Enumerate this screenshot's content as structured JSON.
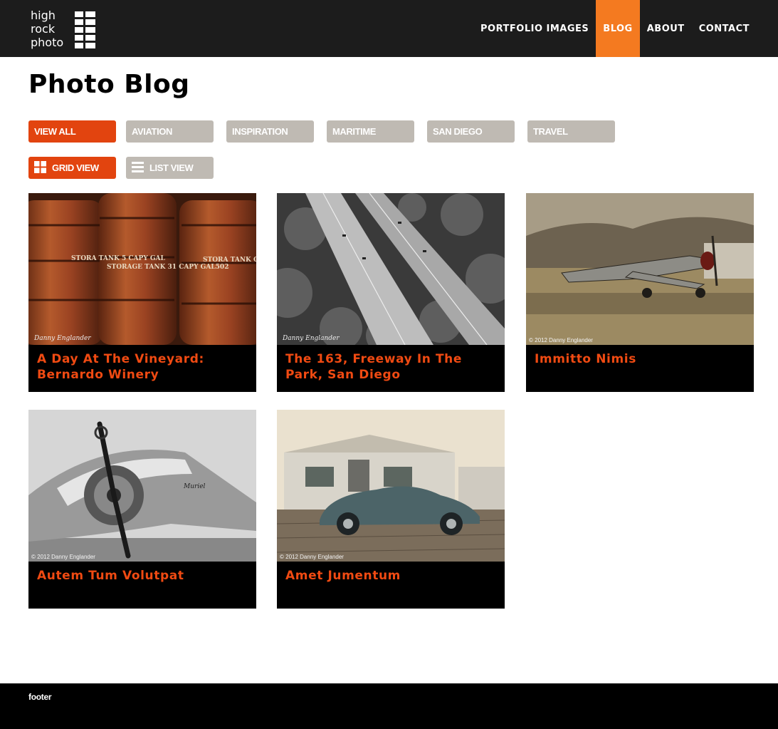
{
  "header": {
    "logo": {
      "line1": "high",
      "line2": "rock",
      "line3": "photo"
    },
    "nav": [
      {
        "label": "PORTFOLIO IMAGES",
        "active": false
      },
      {
        "label": "BLOG",
        "active": true
      },
      {
        "label": "ABOUT",
        "active": false
      },
      {
        "label": "CONTACT",
        "active": false
      }
    ]
  },
  "page": {
    "title": "Photo Blog"
  },
  "filters": [
    {
      "label": "VIEW ALL",
      "active": true
    },
    {
      "label": "AVIATION",
      "active": false
    },
    {
      "label": "INSPIRATION",
      "active": false
    },
    {
      "label": "MARITIME",
      "active": false
    },
    {
      "label": "SAN DIEGO",
      "active": false
    },
    {
      "label": "TRAVEL",
      "active": false
    }
  ],
  "views": [
    {
      "label": "GRID VIEW",
      "icon": "grid-icon",
      "active": true
    },
    {
      "label": "LIST VIEW",
      "icon": "list-icon",
      "active": false
    }
  ],
  "posts": [
    {
      "title": "A Day At The Vineyard: Bernardo Winery",
      "image": "storage-tanks-photo",
      "watermark": "Danny Englander",
      "tank_texts": [
        "STORA TANK 5 CAPY GAL",
        "STORAGE TANK 31 CAPY GAL502",
        "STORA TANK CAPY"
      ]
    },
    {
      "title": "The 163, Freeway In The Park, San Diego",
      "image": "freeway-photo",
      "watermark": "Danny Englander"
    },
    {
      "title": "Immitto Nimis",
      "image": "p51-mustang-photo",
      "watermark": "© 2012 Danny Englander"
    },
    {
      "title": "Autem Tum Volutpat",
      "image": "vintage-plane-photo",
      "watermark": "© 2012 Danny Englander",
      "nose_art": "Muriel"
    },
    {
      "title": "Amet Jumentum",
      "image": "classic-car-photo",
      "watermark": "© 2012 Danny Englander"
    }
  ],
  "footer": {
    "label": "footer"
  },
  "colors": {
    "accent": "#f47a20",
    "button_active": "#e2440f",
    "button_inactive": "#bfbab3",
    "title_text": "#f04a12",
    "header_bg": "#1c1c1c"
  }
}
